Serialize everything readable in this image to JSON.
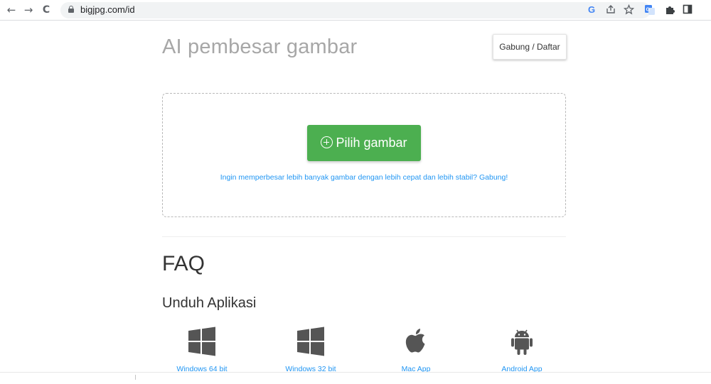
{
  "browser": {
    "back_label": "←",
    "forward_label": "→",
    "reload_label": "C",
    "url": "bigjpg.com/id"
  },
  "header": {
    "title": "AI pembesar gambar",
    "login_label": "Gabung / Daftar"
  },
  "upload": {
    "button_label": "Pilih gambar",
    "join_text": "Ingin memperbesar lebih banyak gambar dengan lebih cepat dan lebih stabil? Gabung!"
  },
  "faq": {
    "heading": "FAQ",
    "apps_heading": "Unduh Aplikasi"
  },
  "apps": [
    {
      "icon": "windows-icon",
      "label": "Windows 64 bit"
    },
    {
      "icon": "windows-icon",
      "label": "Windows 32 bit"
    },
    {
      "icon": "apple-icon",
      "label": "Mac App"
    },
    {
      "icon": "android-icon",
      "label": "Android App"
    }
  ],
  "colors": {
    "accent_green": "#4caf50",
    "link_blue": "#2196f3",
    "title_gray": "#a7a7a7"
  }
}
